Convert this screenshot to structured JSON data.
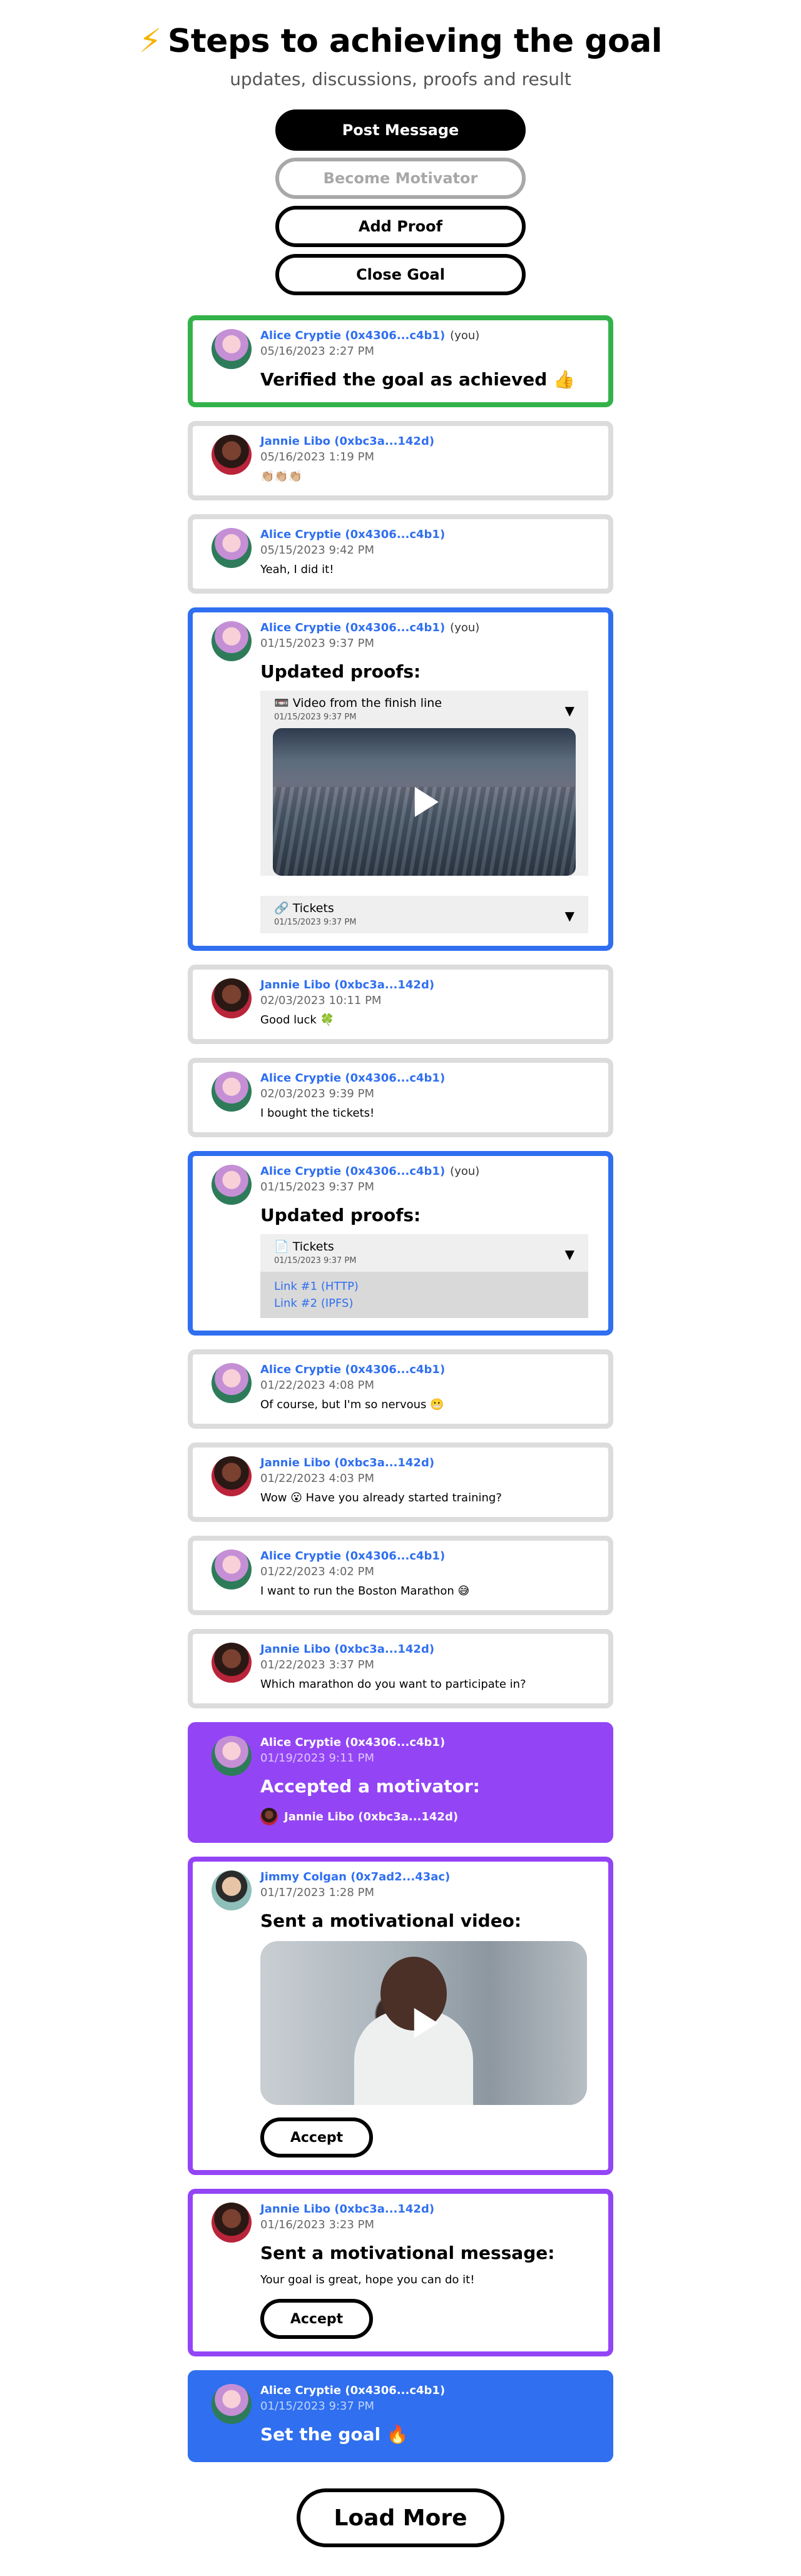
{
  "header": {
    "bolt": "⚡",
    "title": "Steps to achieving the goal",
    "subtitle": "updates, discussions, proofs and result"
  },
  "actions": {
    "post": "Post Message",
    "motivator": "Become Motivator",
    "proof": "Add Proof",
    "close": "Close Goal"
  },
  "you_label": "(you)",
  "posts": [
    {
      "author": "Alice Cryptie (0x4306...c4b1)",
      "time": "05/16/2023 2:27 PM",
      "text": "Verified the goal as achieved 👍"
    },
    {
      "author": "Jannie Libo (0xbc3a...142d)",
      "time": "05/16/2023 1:19 PM",
      "text": "👏🏼👏🏼👏🏼"
    },
    {
      "author": "Alice Cryptie (0x4306...c4b1)",
      "time": "05/15/2023 9:42 PM",
      "text": "Yeah, I did it!"
    },
    {
      "author": "Alice Cryptie (0x4306...c4b1)",
      "time": "01/15/2023 9:37 PM",
      "heading": "Updated proofs:",
      "proof1_title": "📼 Video from the finish line",
      "proof1_date": "01/15/2023 9:37 PM",
      "proof2_title": "🔗 Tickets",
      "proof2_date": "01/15/2023 9:37 PM"
    },
    {
      "author": "Jannie Libo (0xbc3a...142d)",
      "time": "02/03/2023 10:11 PM",
      "text": "Good luck 🍀"
    },
    {
      "author": "Alice Cryptie (0x4306...c4b1)",
      "time": "02/03/2023 9:39 PM",
      "text": "I bought the tickets!"
    },
    {
      "author": "Alice Cryptie (0x4306...c4b1)",
      "time": "01/15/2023 9:37 PM",
      "heading": "Updated proofs:",
      "proof_title": "📄 Tickets",
      "proof_date": "01/15/2023 9:37 PM",
      "link1": "Link #1 (HTTP)",
      "link2": "Link #2 (IPFS)"
    },
    {
      "author": "Alice Cryptie (0x4306...c4b1)",
      "time": "01/22/2023 4:08 PM",
      "text": "Of course, but I'm so nervous 😬"
    },
    {
      "author": "Jannie Libo (0xbc3a...142d)",
      "time": "01/22/2023 4:03 PM",
      "text": "Wow 😮 Have you already started training?"
    },
    {
      "author": "Alice Cryptie (0x4306...c4b1)",
      "time": "01/22/2023 4:02 PM",
      "text": "I want to run the Boston Marathon 😅"
    },
    {
      "author": "Jannie Libo (0xbc3a...142d)",
      "time": "01/22/2023 3:37 PM",
      "text": "Which marathon do you want to participate in?"
    },
    {
      "author": "Alice Cryptie (0x4306...c4b1)",
      "time": "01/19/2023 9:11 PM",
      "heading": "Accepted a motivator:",
      "motivator": "Jannie Libo (0xbc3a...142d)"
    },
    {
      "author": "Jimmy Colgan (0x7ad2...43ac)",
      "time": "01/17/2023 1:28 PM",
      "heading": "Sent a motivational video:",
      "button": "Accept"
    },
    {
      "author": "Jannie Libo (0xbc3a...142d)",
      "time": "01/16/2023 3:23 PM",
      "heading": "Sent a motivational message:",
      "text": "Your goal is great, hope you can do it!",
      "button": "Accept"
    },
    {
      "author": "Alice Cryptie (0x4306...c4b1)",
      "time": "01/15/2023 9:37 PM",
      "heading": "Set the goal 🔥"
    }
  ],
  "load_more": "Load More",
  "colors": {
    "verified": "#34b24a",
    "proof": "#2f6ff0",
    "motivation": "#9345f5",
    "goal": "#2f6ff0",
    "link": "#2f6ff0"
  },
  "icons": {
    "expand": "chevron-down-icon",
    "video": "play-icon"
  }
}
